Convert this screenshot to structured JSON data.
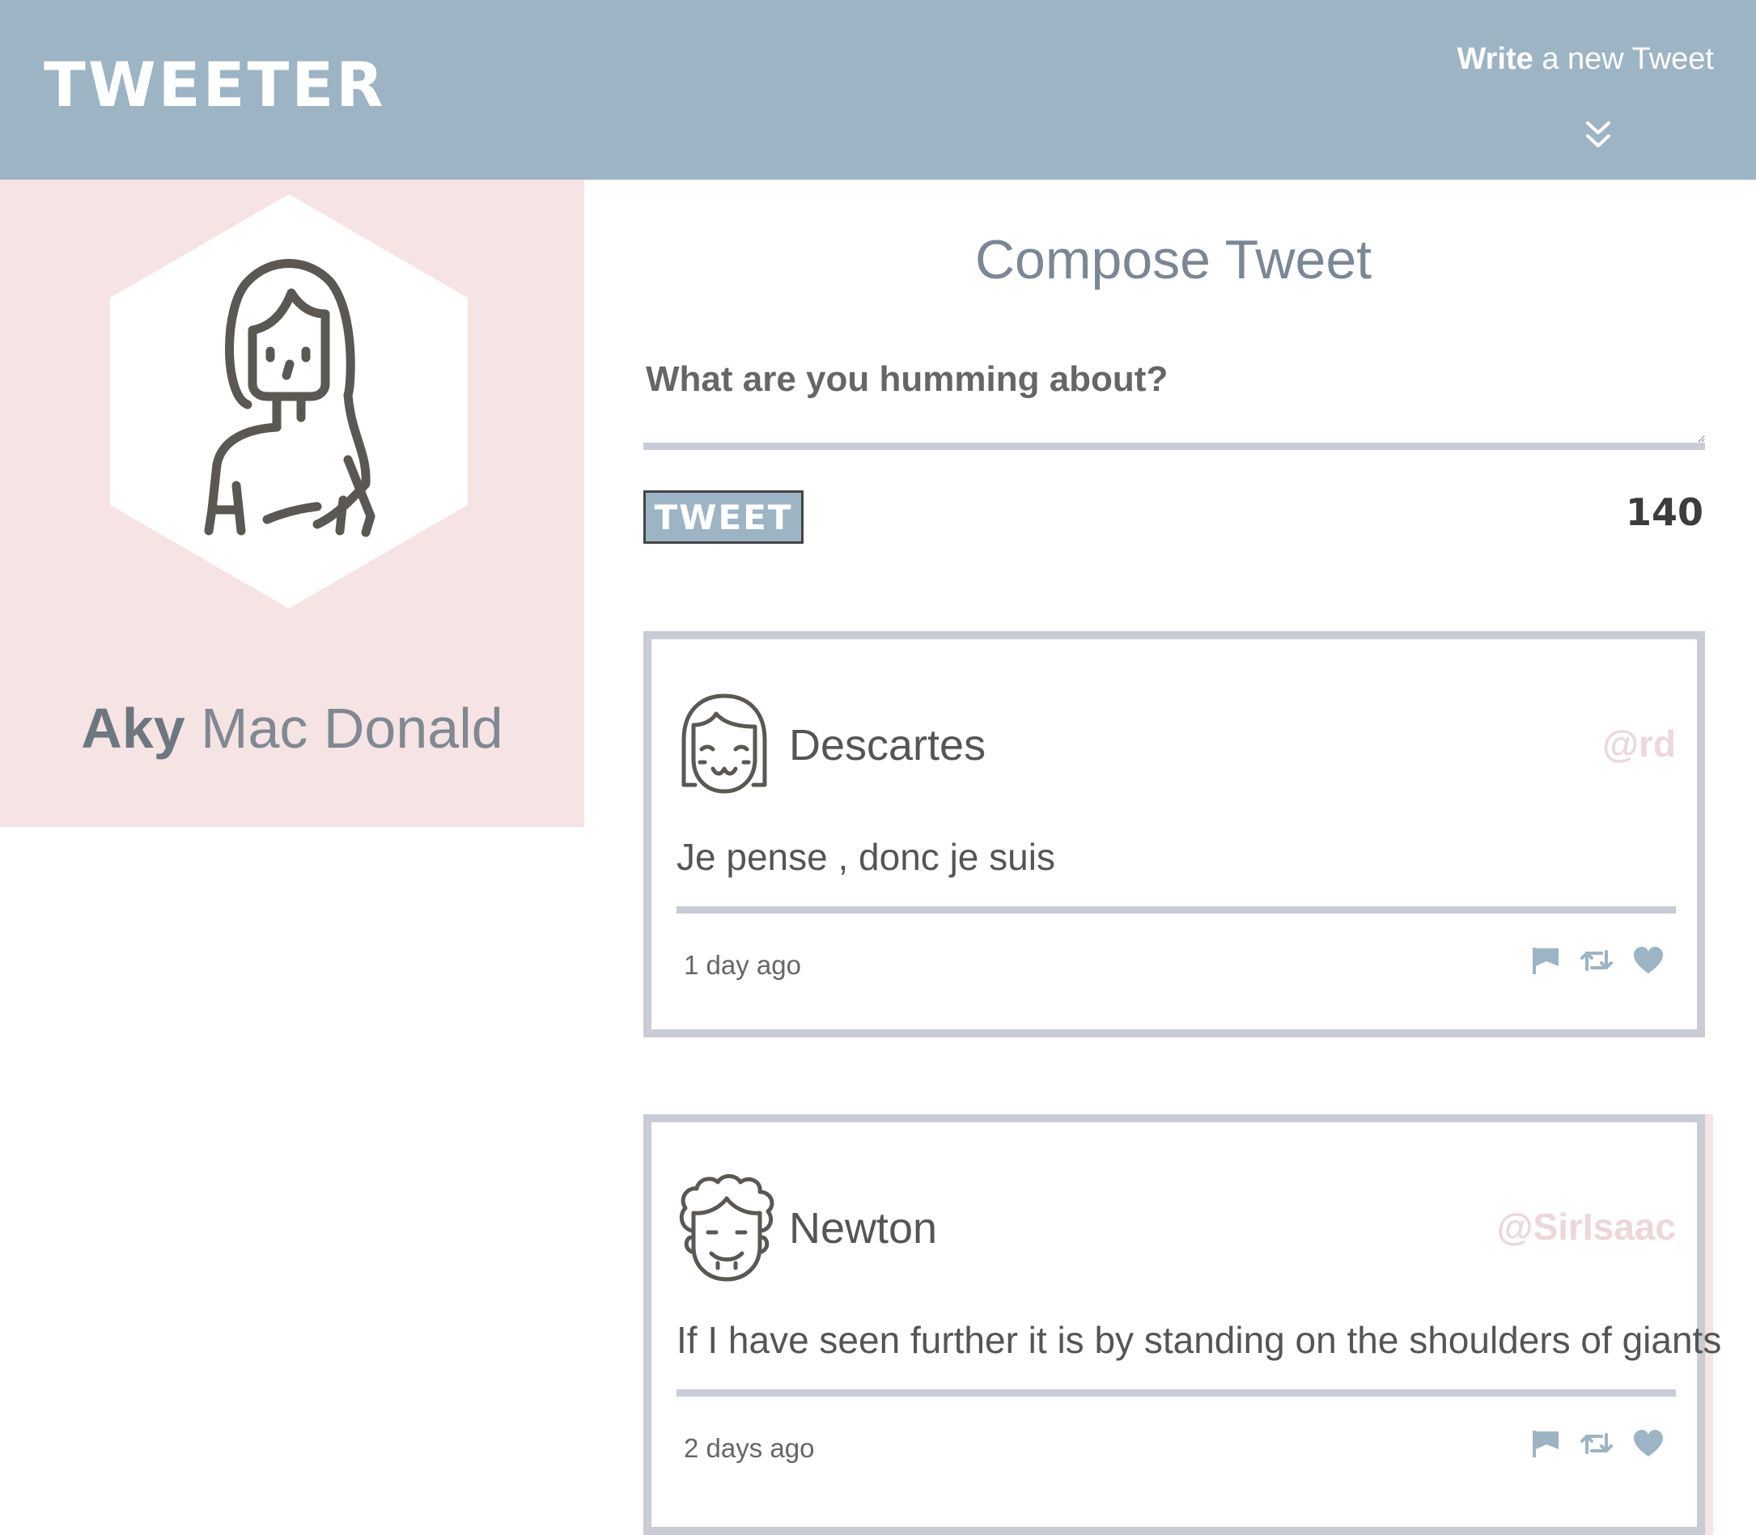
{
  "header": {
    "logo": "TWEETER",
    "write_bold": "Write",
    "write_rest": " a new Tweet"
  },
  "profile": {
    "first_name": "Aky",
    "last_name": " Mac Donald"
  },
  "compose": {
    "title": "Compose Tweet",
    "placeholder": "What are you humming about?",
    "button": "TWEET",
    "counter": "140"
  },
  "tweets": [
    {
      "name": "Descartes",
      "handle": "@rd",
      "text": "Je pense , donc je suis",
      "time": "1 day ago"
    },
    {
      "name": "Newton",
      "handle": "@SirIsaac",
      "text": "If I have seen further it is by standing on the shoulders of giants",
      "time": "2 days ago"
    }
  ],
  "icons": {
    "flag": "flag-icon",
    "retweet": "retweet-icon",
    "like": "heart-icon"
  },
  "colors": {
    "accent": "#9cb4c4",
    "profile_bg": "#f6e3e4",
    "border": "#c9ccd4",
    "handle": "#ecd7da",
    "avatar_stroke": "#5b5853"
  }
}
